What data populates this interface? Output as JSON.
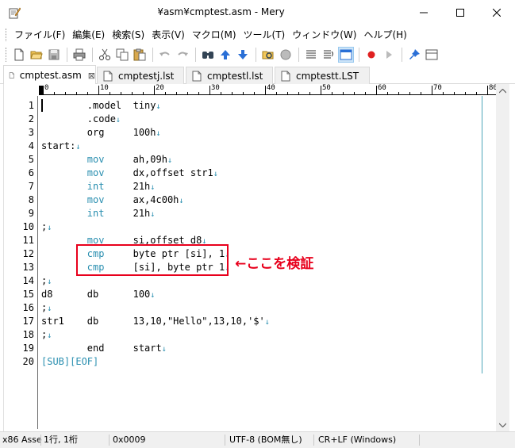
{
  "window": {
    "title": "¥asm¥cmptest.asm - Mery"
  },
  "menu": [
    "ファイル(F)",
    "編集(E)",
    "検索(S)",
    "表示(V)",
    "マクロ(M)",
    "ツール(T)",
    "ウィンドウ(W)",
    "ヘルプ(H)"
  ],
  "toolbar_icons": [
    "new-file-icon",
    "open-folder-icon",
    "save-icon",
    "print-icon",
    "cut-icon",
    "copy-icon",
    "paste-icon",
    "undo-icon",
    "redo-icon",
    "find-icon",
    "find-up-icon",
    "find-down-icon",
    "replace-icon",
    "grep-icon",
    "word-wrap-icon",
    "line-number-icon",
    "window-icon",
    "record-macro-icon",
    "play-macro-icon",
    "pin-icon",
    "panel-icon"
  ],
  "tabs": [
    {
      "label": "cmptest.asm",
      "active": true
    },
    {
      "label": "cmptestj.lst",
      "active": false
    },
    {
      "label": "cmptestl.lst",
      "active": false
    },
    {
      "label": "cmptestt.LST",
      "active": false
    }
  ],
  "ruler": [
    "0",
    "10",
    "20",
    "30",
    "40",
    "50",
    "60",
    "70",
    "80"
  ],
  "editor": {
    "lines": [
      {
        "num": "1",
        "segs": [
          {
            "t": "        .model  tiny",
            "c": ""
          }
        ]
      },
      {
        "num": "2",
        "segs": [
          {
            "t": "        .code",
            "c": ""
          }
        ]
      },
      {
        "num": "3",
        "segs": [
          {
            "t": "        org     100h",
            "c": ""
          }
        ]
      },
      {
        "num": "4",
        "segs": [
          {
            "t": "start:",
            "c": ""
          }
        ]
      },
      {
        "num": "5",
        "segs": [
          {
            "t": "        ",
            "c": ""
          },
          {
            "t": "mov",
            "c": "kw"
          },
          {
            "t": "     ah,09h",
            "c": ""
          }
        ]
      },
      {
        "num": "6",
        "segs": [
          {
            "t": "        ",
            "c": ""
          },
          {
            "t": "mov",
            "c": "kw"
          },
          {
            "t": "     dx,offset str1",
            "c": ""
          }
        ]
      },
      {
        "num": "7",
        "segs": [
          {
            "t": "        ",
            "c": ""
          },
          {
            "t": "int",
            "c": "kw"
          },
          {
            "t": "     21h",
            "c": ""
          }
        ]
      },
      {
        "num": "8",
        "segs": [
          {
            "t": "        ",
            "c": ""
          },
          {
            "t": "mov",
            "c": "kw"
          },
          {
            "t": "     ax,4c00h",
            "c": ""
          }
        ]
      },
      {
        "num": "9",
        "segs": [
          {
            "t": "        ",
            "c": ""
          },
          {
            "t": "int",
            "c": "kw"
          },
          {
            "t": "     21h",
            "c": ""
          }
        ]
      },
      {
        "num": "10",
        "segs": [
          {
            "t": ";",
            "c": ""
          }
        ]
      },
      {
        "num": "11",
        "segs": [
          {
            "t": "        ",
            "c": ""
          },
          {
            "t": "mov",
            "c": "kw"
          },
          {
            "t": "     si,offset d8",
            "c": ""
          }
        ]
      },
      {
        "num": "12",
        "segs": [
          {
            "t": "        ",
            "c": ""
          },
          {
            "t": "cmp",
            "c": "kw"
          },
          {
            "t": "     byte ptr [si], 1",
            "c": ""
          }
        ]
      },
      {
        "num": "13",
        "segs": [
          {
            "t": "        ",
            "c": ""
          },
          {
            "t": "cmp",
            "c": "kw"
          },
          {
            "t": "     [si], byte ptr 1",
            "c": ""
          }
        ]
      },
      {
        "num": "14",
        "segs": [
          {
            "t": ";",
            "c": ""
          }
        ]
      },
      {
        "num": "15",
        "segs": [
          {
            "t": "d8      db      100",
            "c": ""
          }
        ]
      },
      {
        "num": "16",
        "segs": [
          {
            "t": ";",
            "c": ""
          }
        ]
      },
      {
        "num": "17",
        "segs": [
          {
            "t": "str1    db      13,10,\"Hello\",13,10,'$'",
            "c": ""
          }
        ]
      },
      {
        "num": "18",
        "segs": [
          {
            "t": ";",
            "c": ""
          }
        ]
      },
      {
        "num": "19",
        "segs": [
          {
            "t": "        end     start",
            "c": ""
          }
        ]
      },
      {
        "num": "20",
        "segs": [
          {
            "t": "[SUB][EOF]",
            "c": "eof"
          }
        ]
      }
    ],
    "return_mark": "↓"
  },
  "annotation": {
    "text": "←ここを検証",
    "color": "#e8001c"
  },
  "statusbar": {
    "mode": "x86 Asse",
    "position": "1行, 1桁",
    "char_code": "0x0009",
    "encoding": "UTF-8 (BOM無し)",
    "line_ending": "CR+LF (Windows)"
  },
  "colors": {
    "keyword": "#2a8fb0",
    "highlight": "#e8001c"
  }
}
